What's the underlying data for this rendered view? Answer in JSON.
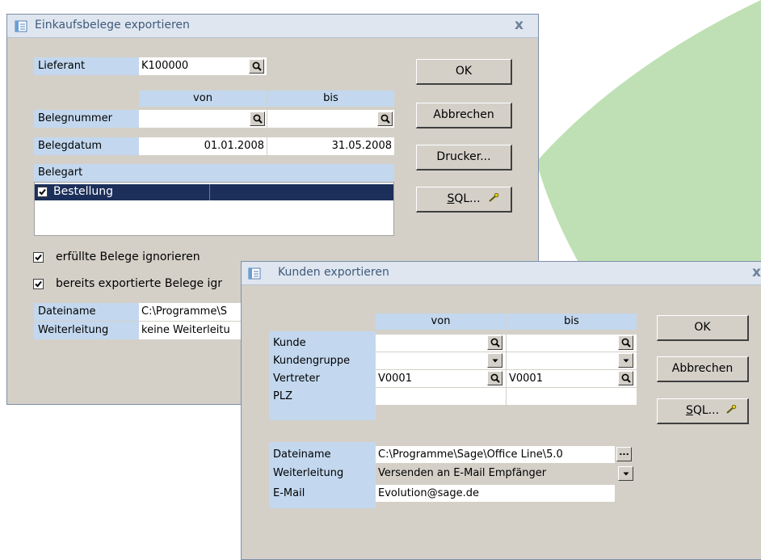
{
  "win1": {
    "title": "Einkaufsbelege exportieren",
    "close": "x",
    "labels": {
      "lieferant": "Lieferant",
      "belegnummer": "Belegnummer",
      "belegdatum": "Belegdatum",
      "belegart": "Belegart",
      "dateiname": "Dateiname",
      "weiterleitung": "Weiterleitung"
    },
    "col_von": "von",
    "col_bis": "bis",
    "values": {
      "lieferant": "K100000",
      "belegnummer_von": "",
      "belegnummer_bis": "",
      "belegdatum_von": "01.01.2008",
      "belegdatum_bis": "31.05.2008",
      "dateiname": "C:\\Programme\\S",
      "weiterleitung": "keine Weiterleitu"
    },
    "belegart_items": [
      {
        "label": "Bestellung",
        "checked": true
      }
    ],
    "checkbox_erfuellt": "erfüllte Belege ignorieren",
    "checkbox_exportiert": "bereits exportierte Belege igr",
    "buttons": {
      "ok": "OK",
      "abbrechen": "Abbrechen",
      "drucker": "Drucker...",
      "sql_u": "S",
      "sql_rest": "QL..."
    }
  },
  "win2": {
    "title": "Kunden exportieren",
    "close": "x",
    "col_von": "von",
    "col_bis": "bis",
    "labels": {
      "kunde": "Kunde",
      "kundengruppe": "Kundengruppe",
      "vertreter": "Vertreter",
      "plz": "PLZ",
      "dateiname": "Dateiname",
      "weiterleitung": "Weiterleitung",
      "email": "E-Mail"
    },
    "values": {
      "kunde_von": "",
      "kunde_bis": "",
      "kundengruppe_von": "",
      "kundengruppe_bis": "",
      "vertreter_von": "V0001",
      "vertreter_bis": "V0001",
      "plz_von": "",
      "plz_bis": "",
      "dateiname": "C:\\Programme\\Sage\\Office Line\\5.0",
      "weiterleitung": "Versenden an E-Mail Empfänger",
      "email": "Evolution@sage.de"
    },
    "browse": "...",
    "buttons": {
      "ok": "OK",
      "abbrechen": "Abbrechen",
      "sql_u": "S",
      "sql_rest": "QL..."
    }
  },
  "colors": {
    "label_bg": "#c3d8ef",
    "dialog_bg": "#d4d0c8",
    "selection": "#1c2f5a",
    "deco_green": "#bfe0b4"
  },
  "icons": [
    "app-icon",
    "magnifier-icon",
    "dropdown-arrow-icon",
    "checkmark-icon",
    "wand-icon",
    "close-icon"
  ]
}
